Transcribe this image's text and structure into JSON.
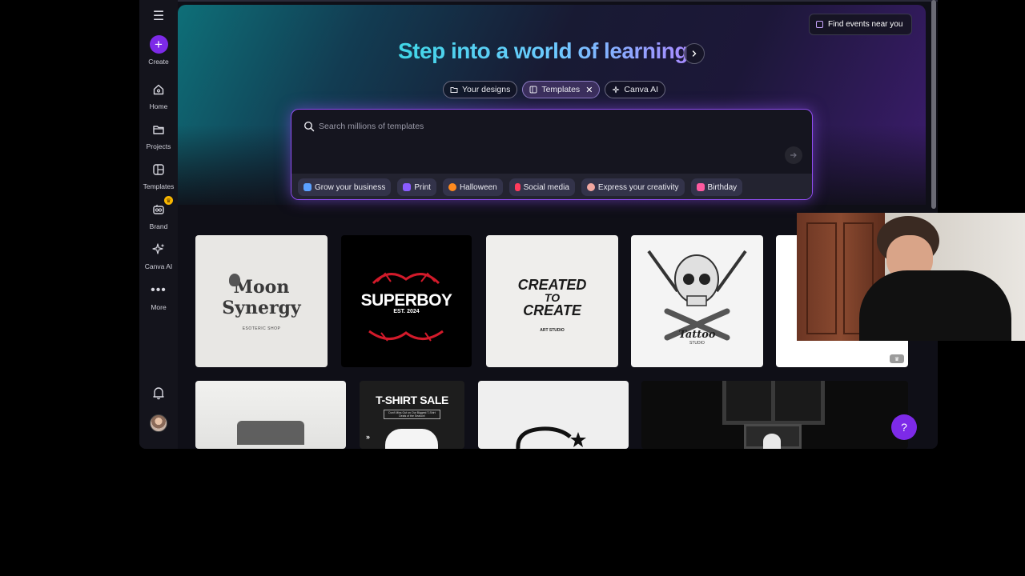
{
  "sidebar": {
    "create": "Create",
    "items": [
      {
        "label": "Home",
        "icon": "home-icon"
      },
      {
        "label": "Projects",
        "icon": "folder-icon"
      },
      {
        "label": "Templates",
        "icon": "templates-icon"
      },
      {
        "label": "Brand",
        "icon": "brand-icon"
      },
      {
        "label": "Canva AI",
        "icon": "sparkle-icon"
      },
      {
        "label": "More",
        "icon": "more-icon"
      }
    ],
    "brand_badge": "♛"
  },
  "header": {
    "events_button": "Find events near you",
    "title": "Step into a world of learning"
  },
  "chips": [
    {
      "label": "Your designs",
      "active": false
    },
    {
      "label": "Templates",
      "active": true
    },
    {
      "label": "Canva AI",
      "active": false
    }
  ],
  "search": {
    "placeholder": "Search millions of templates"
  },
  "suggestions": [
    {
      "label": "Grow your business",
      "color": "#5aa0ff"
    },
    {
      "label": "Print",
      "color": "#8a5cff"
    },
    {
      "label": "Halloween",
      "color": "#ff8a1f"
    },
    {
      "label": "Social media",
      "color": "#ff3b5c"
    },
    {
      "label": "Express your creativity",
      "color": "#f1a7a0"
    },
    {
      "label": "Birthday",
      "color": "#ff5aa0"
    }
  ],
  "templates_row1": [
    {
      "line1": "Moon",
      "line2": "Synergy",
      "sub": "ESOTERIC SHOP"
    },
    {
      "line1": "SUPERBOY",
      "sub": "EST. 2024"
    },
    {
      "line1": "CREATED",
      "line2": "TO",
      "line3": "CREATE",
      "sub": "ART STUDIO"
    },
    {
      "line1": "Tattoo",
      "sub": "STUDIO"
    }
  ],
  "templates_row2": [
    {
      "line1": "T-SHIRT SALE",
      "sub": "Don't Miss Out on Our Biggest T-Shirt Deals of the Season!"
    }
  ],
  "help": "?"
}
